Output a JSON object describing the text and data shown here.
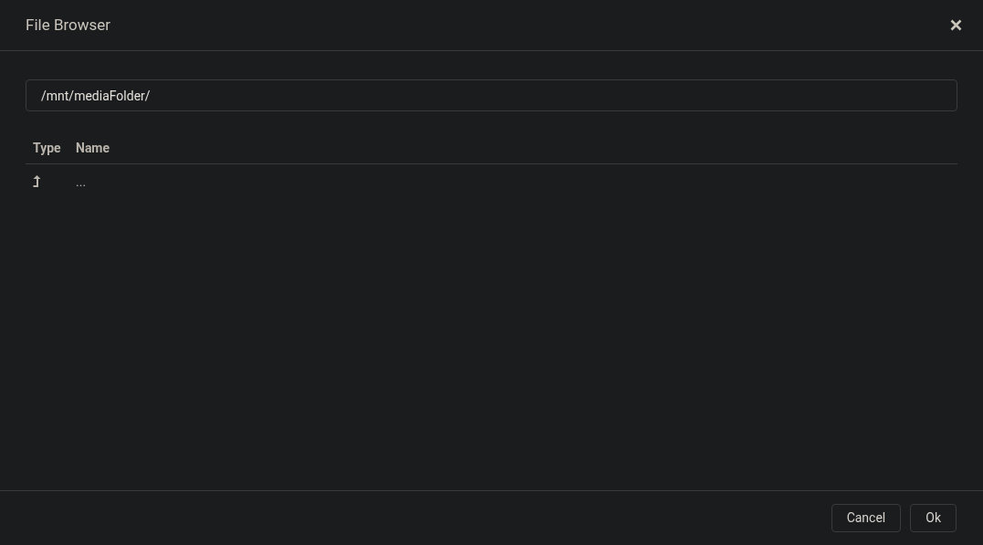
{
  "dialog": {
    "title": "File Browser"
  },
  "path_field": {
    "value": "/mnt/mediaFolder/"
  },
  "table": {
    "columns": [
      "Type",
      "Name"
    ],
    "rows": [
      {
        "kind": "parent",
        "name": "..."
      }
    ]
  },
  "buttons": [
    "Cancel",
    "Ok"
  ]
}
